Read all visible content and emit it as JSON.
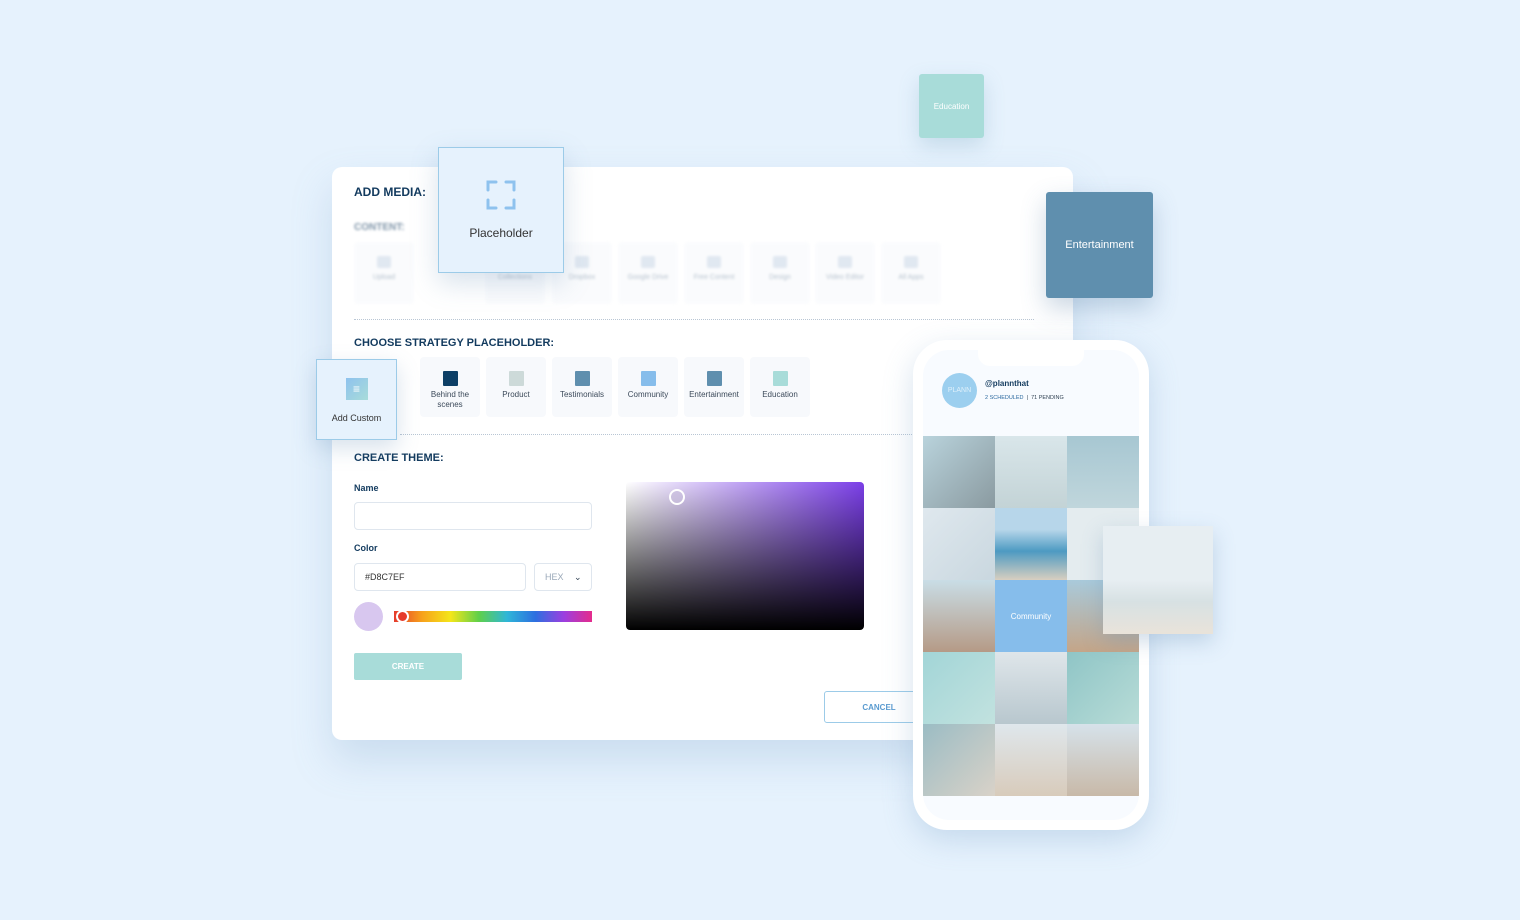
{
  "floating": {
    "education": "Education",
    "entertainment": "Entertainment",
    "placeholder": "Placeholder",
    "add_custom": "Add Custom"
  },
  "add_media": {
    "title": "ADD MEDIA:",
    "content_label": "CONTENT:",
    "sources": [
      "Upload",
      "Collections",
      "Dropbox",
      "Google Drive",
      "Free Content",
      "Design",
      "Video Editor",
      "All Apps"
    ]
  },
  "strategy": {
    "title": "CHOOSE STRATEGY PLACEHOLDER:",
    "items": [
      {
        "label": "Behind the scenes",
        "color": "#0d3f66"
      },
      {
        "label": "Product",
        "color": "#cddad9"
      },
      {
        "label": "Testimonials",
        "color": "#5f8fae"
      },
      {
        "label": "Community",
        "color": "#86bdeb"
      },
      {
        "label": "Entertainment",
        "color": "#5f8fae"
      },
      {
        "label": "Education",
        "color": "#a8dcd9"
      }
    ]
  },
  "theme": {
    "title": "CREATE  THEME:",
    "name_label": "Name",
    "name_value": "",
    "color_label": "Color",
    "color_value": "#D8C7EF",
    "format": "HEX",
    "create": "CREATE",
    "cancel": "CANCEL",
    "preview_color": "#d8c7ef",
    "picker_hue_color": "#7b3fe8"
  },
  "phone": {
    "avatar": "PLANN",
    "handle": "@plannthat",
    "scheduled": "2 SCHEDULED",
    "pending": "71 PENDING",
    "community_tile": "Community"
  }
}
